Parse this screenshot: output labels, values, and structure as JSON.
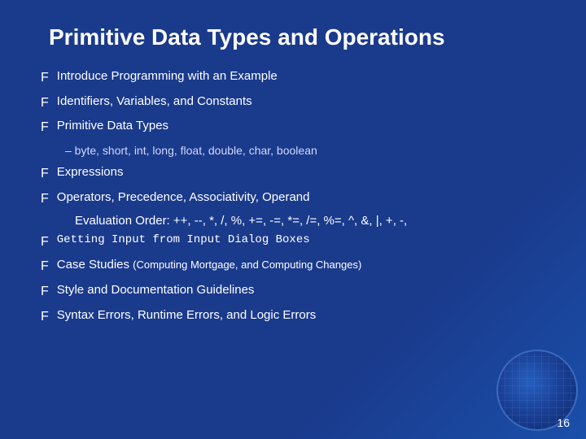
{
  "slide": {
    "title": "Primitive Data Types and Operations",
    "bullet_arrow": "F",
    "bullets": [
      {
        "id": "b1",
        "text": "Introduce Programming with an Example",
        "monospace": false,
        "sub": null
      },
      {
        "id": "b2",
        "text": "Identifiers, Variables, and Constants",
        "monospace": false,
        "sub": null
      },
      {
        "id": "b3",
        "text": "Primitive Data Types",
        "monospace": false,
        "sub": "– byte, short, int, long, float, double, char, boolean"
      },
      {
        "id": "b4",
        "text": "Expressions",
        "monospace": false,
        "sub": null
      },
      {
        "id": "b5",
        "text": "Operators, Precedence, Associativity, Operand",
        "monospace": false,
        "sub": null,
        "continuation": "Evaluation Order: ++, --, *, /, %, +=, -=, *=, /=, %=, ^, &, |, +, -,"
      },
      {
        "id": "b6",
        "text": "Getting Input from Input Dialog Boxes",
        "monospace": true,
        "sub": null
      },
      {
        "id": "b7",
        "text": "Case Studies ",
        "monospace": false,
        "small_suffix": "(Computing Mortgage, and Computing Changes)",
        "sub": null
      },
      {
        "id": "b8",
        "text": "Style and Documentation Guidelines",
        "monospace": false,
        "sub": null
      },
      {
        "id": "b9",
        "text": "Syntax Errors, Runtime Errors, and Logic Errors",
        "monospace": false,
        "sub": null
      }
    ],
    "page_number": "16"
  }
}
